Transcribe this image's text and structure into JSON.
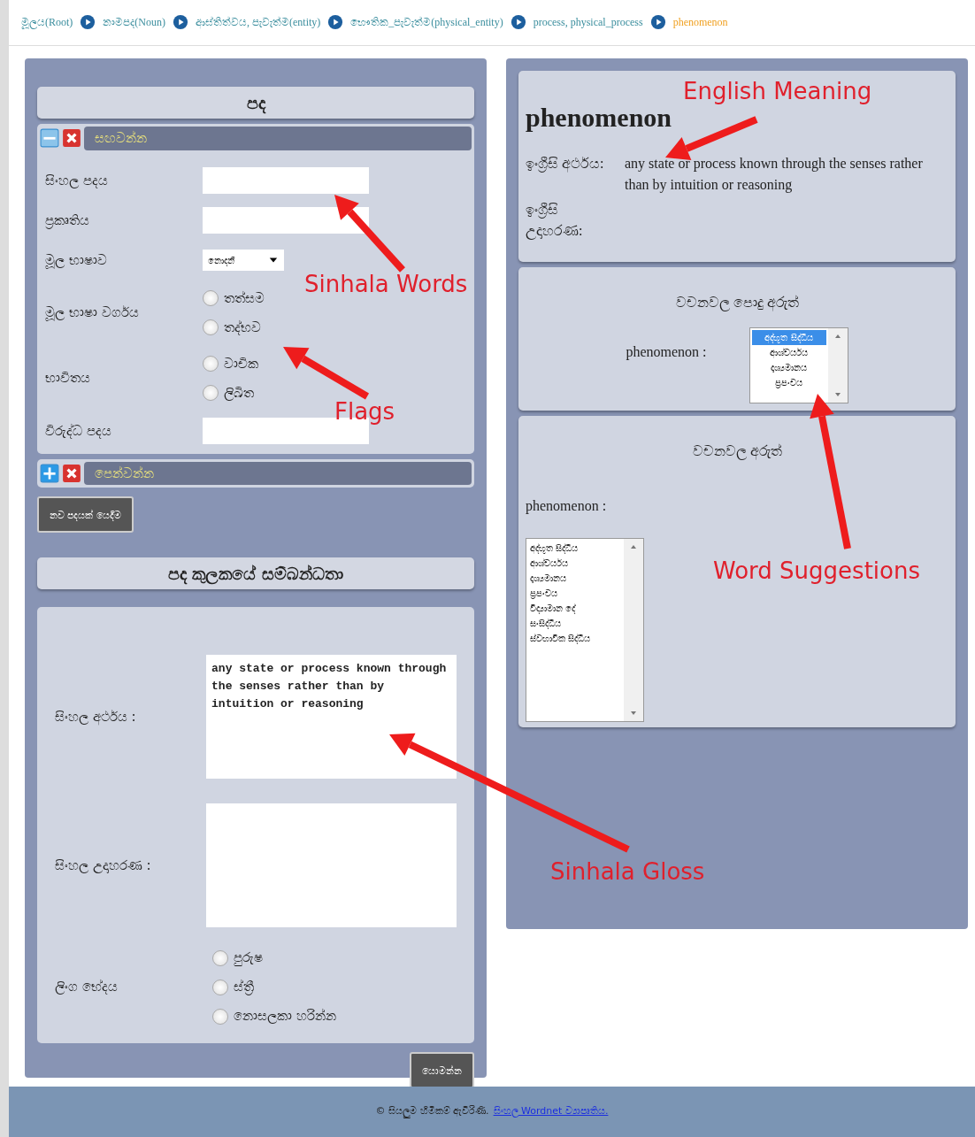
{
  "breadcrumb": [
    {
      "label": "මූලය(Root)",
      "current": false
    },
    {
      "label": "නාමපද(Noun)",
      "current": false
    },
    {
      "label": "ආස්තිත්වය, පැවැත්ම(entity)",
      "current": false
    },
    {
      "label": "භෞතික_පැවැත්ම(physical_entity)",
      "current": false
    },
    {
      "label": "process, physical_process",
      "current": false
    },
    {
      "label": "phenomenon",
      "current": true
    }
  ],
  "word_panel": {
    "title": "පද",
    "sections": [
      {
        "label": "සඟවන්න",
        "expanded": true,
        "rows": [
          {
            "kind": "text",
            "label": "සිංහල පදය"
          },
          {
            "kind": "text",
            "label": "ප්‍රකෘතිය"
          },
          {
            "kind": "select",
            "label": "මූල භාෂාව",
            "value": "නොදනී"
          },
          {
            "kind": "radio",
            "label": "මූල භාෂා වර්ගය",
            "options": [
              {
                "label": "තත්සම",
                "selected": false
              },
              {
                "label": "තද්භව",
                "selected": false
              }
            ]
          },
          {
            "kind": "radio",
            "label": "භාවිතය",
            "options": [
              {
                "label": "වාචික",
                "selected": false
              },
              {
                "label": "ලිඛිත",
                "selected": false
              }
            ]
          },
          {
            "kind": "text",
            "label": "විරුද්ධ පදය"
          }
        ]
      },
      {
        "label": "පෙන්වන්න",
        "expanded": false
      }
    ],
    "add_button": "නව පදයක් යෙදීම"
  },
  "relations_panel": {
    "title": "පද කුලකයේ සම්බන්ධතා",
    "rows": [
      {
        "kind": "textarea",
        "label": "සිංහල අර්ථය :",
        "value": "any state or process known through the senses rather than by intuition or reasoning"
      },
      {
        "kind": "textarea",
        "label": "සිංහල උදාහරණ :",
        "value": ""
      },
      {
        "kind": "radio",
        "label": "ලිංග භේදය",
        "options": [
          {
            "label": "පුරුෂ",
            "selected": false
          },
          {
            "label": "ස්ත්‍රී",
            "selected": false
          },
          {
            "label": "නොසලකා හරින්න",
            "selected": false
          }
        ]
      }
    ],
    "submit_button": "යොමන්න"
  },
  "english_card": {
    "word": "phenomenon",
    "meaning_label": "ඉංග්‍රීසි අර්ථය:",
    "meaning": "any state or process known through the senses rather than by intuition or reasoning",
    "example_label": "ඉංග්‍රීසි උදාහරණ:"
  },
  "common_meanings": {
    "title": "වචනවල පොදු අරුත්",
    "word": "phenomenon :",
    "items": [
      {
        "label": "අද්භූත සිද්ධිය",
        "selected": true
      },
      {
        "label": "ආශ්චර්යය",
        "selected": false
      },
      {
        "label": "දෘශ්‍යමානය",
        "selected": false
      },
      {
        "label": "ප්‍රපංචය",
        "selected": false
      }
    ]
  },
  "meanings": {
    "title": "වචනවල අරුත්",
    "word": "phenomenon :",
    "items": [
      {
        "label": "අද්භූත සිද්ධිය",
        "selected": false
      },
      {
        "label": "ආශ්චර්යය",
        "selected": false
      },
      {
        "label": "දෘශ්‍යමානය",
        "selected": false
      },
      {
        "label": "ප්‍රපංචය",
        "selected": false
      },
      {
        "label": "විද්‍යාමාන දේ",
        "selected": false
      },
      {
        "label": "සංසිද්ධිය",
        "selected": false
      },
      {
        "label": "ස්වභාවික සිද්ධිය",
        "selected": false
      }
    ]
  },
  "footer": {
    "text": "© සියලුම හිමිකම් ඇවිරිණි.",
    "link": "සිංහල Wordnet ව්‍යාපෘතිය."
  },
  "annotations": [
    "English Meaning",
    "Sinhala Words",
    "Flags",
    "Word Suggestions",
    "Sinhala Gloss"
  ]
}
